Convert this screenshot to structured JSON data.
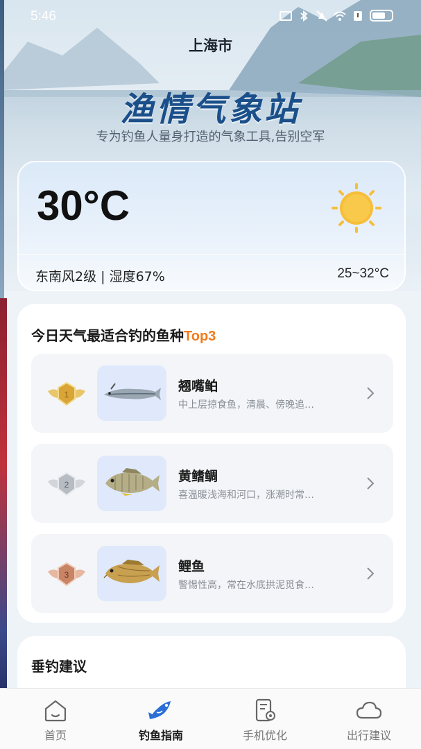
{
  "status_bar": {
    "time": "5:46"
  },
  "header": {
    "city": "上海市",
    "app_title": "渔情气象站",
    "subtitle": "专为钓鱼人量身打造的气象工具,告别空军"
  },
  "weather": {
    "temperature": "30°C",
    "condition_icon": "sun-icon",
    "wind_humidity": "东南风2级 | 湿度67%",
    "temp_range": "25~32°C"
  },
  "fish_section": {
    "heading_prefix": "今日天气最适合钓的鱼种",
    "heading_accent": "Top3",
    "items": [
      {
        "rank": 1,
        "medal": "gold-medal-icon",
        "name": "翘嘴鲌",
        "desc": "中上层掠食鱼，清晨、傍晚追…"
      },
      {
        "rank": 2,
        "medal": "silver-medal-icon",
        "name": "黄鳍鲷",
        "desc": "喜温暖浅海和河口，涨潮时常…"
      },
      {
        "rank": 3,
        "medal": "bronze-medal-icon",
        "name": "鲤鱼",
        "desc": "警惕性高，常在水底拱泥觅食…"
      }
    ]
  },
  "advice": {
    "title": "垂钓建议"
  },
  "tabs": [
    {
      "label": "首页",
      "icon": "home-icon",
      "active": false
    },
    {
      "label": "钓鱼指南",
      "icon": "fish-icon",
      "active": true
    },
    {
      "label": "手机优化",
      "icon": "phone-settings-icon",
      "active": false
    },
    {
      "label": "出行建议",
      "icon": "cloud-icon",
      "active": false
    }
  ],
  "colors": {
    "accent": "#f27b1a",
    "title_blue": "#1b4f8a",
    "tab_active_blue": "#2a6fd6"
  }
}
